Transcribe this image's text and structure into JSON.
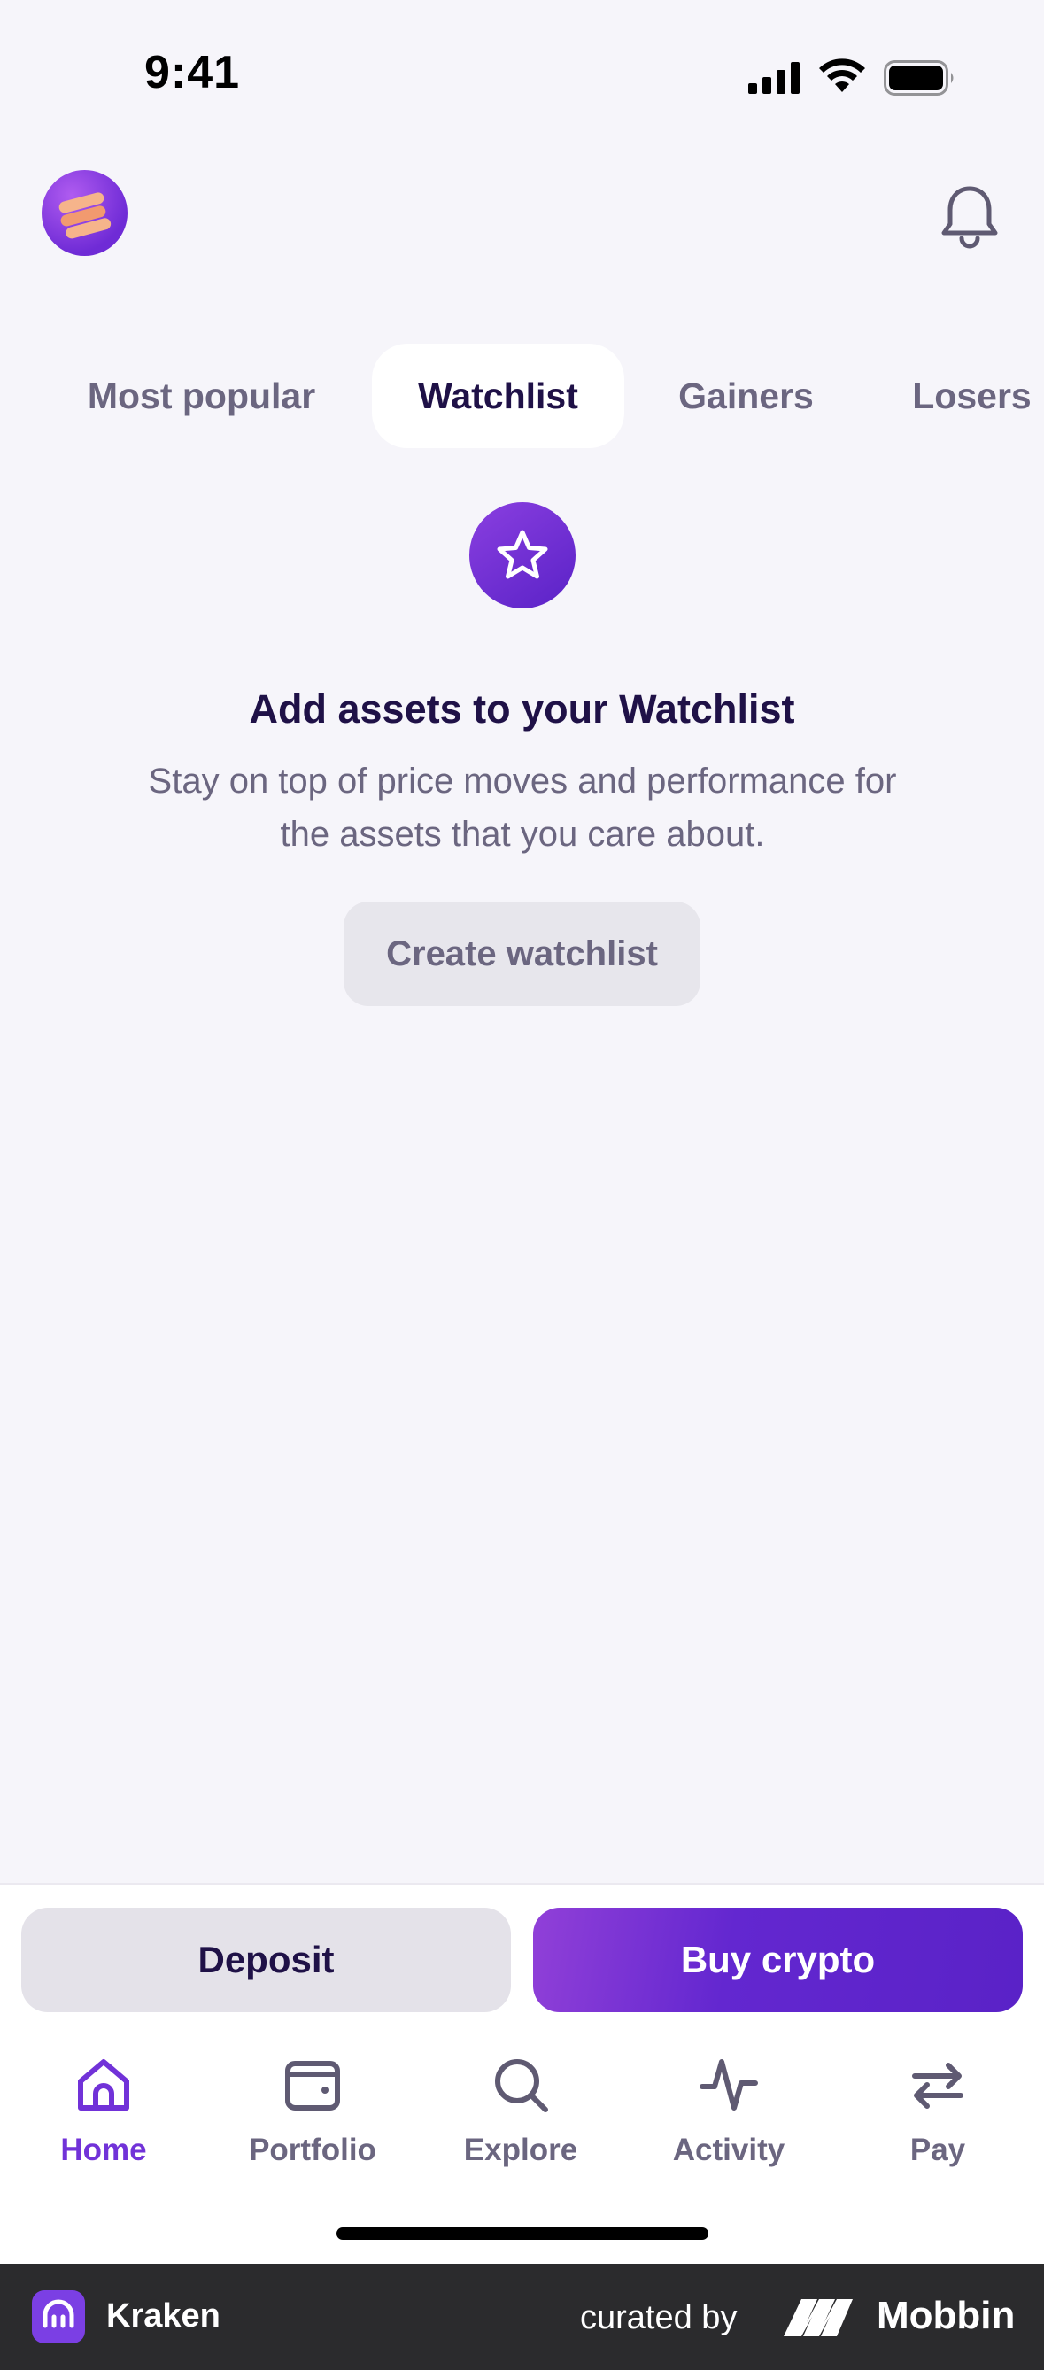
{
  "status_bar": {
    "time": "9:41"
  },
  "tabs": [
    {
      "label": "Most popular",
      "active": false
    },
    {
      "label": "Watchlist",
      "active": true
    },
    {
      "label": "Gainers",
      "active": false
    },
    {
      "label": "Losers",
      "active": false
    }
  ],
  "empty_state": {
    "icon": "star-icon",
    "title": "Add assets to your Watchlist",
    "description": "Stay on top of price moves and performance for the assets that you care about.",
    "button_label": "Create watchlist"
  },
  "actions": {
    "deposit_label": "Deposit",
    "buy_label": "Buy crypto"
  },
  "nav": [
    {
      "label": "Home",
      "icon": "home-icon",
      "active": true
    },
    {
      "label": "Portfolio",
      "icon": "wallet-icon",
      "active": false
    },
    {
      "label": "Explore",
      "icon": "search-icon",
      "active": false
    },
    {
      "label": "Activity",
      "icon": "activity-icon",
      "active": false
    },
    {
      "label": "Pay",
      "icon": "transfer-icon",
      "active": false
    }
  ],
  "footer": {
    "app_name": "Kraken",
    "curated_by": "curated by",
    "brand": "Mobbin"
  },
  "colors": {
    "accent": "#7132d8",
    "background": "#f6f5fa",
    "text_primary": "#1f1147",
    "text_secondary": "#6b6680"
  }
}
